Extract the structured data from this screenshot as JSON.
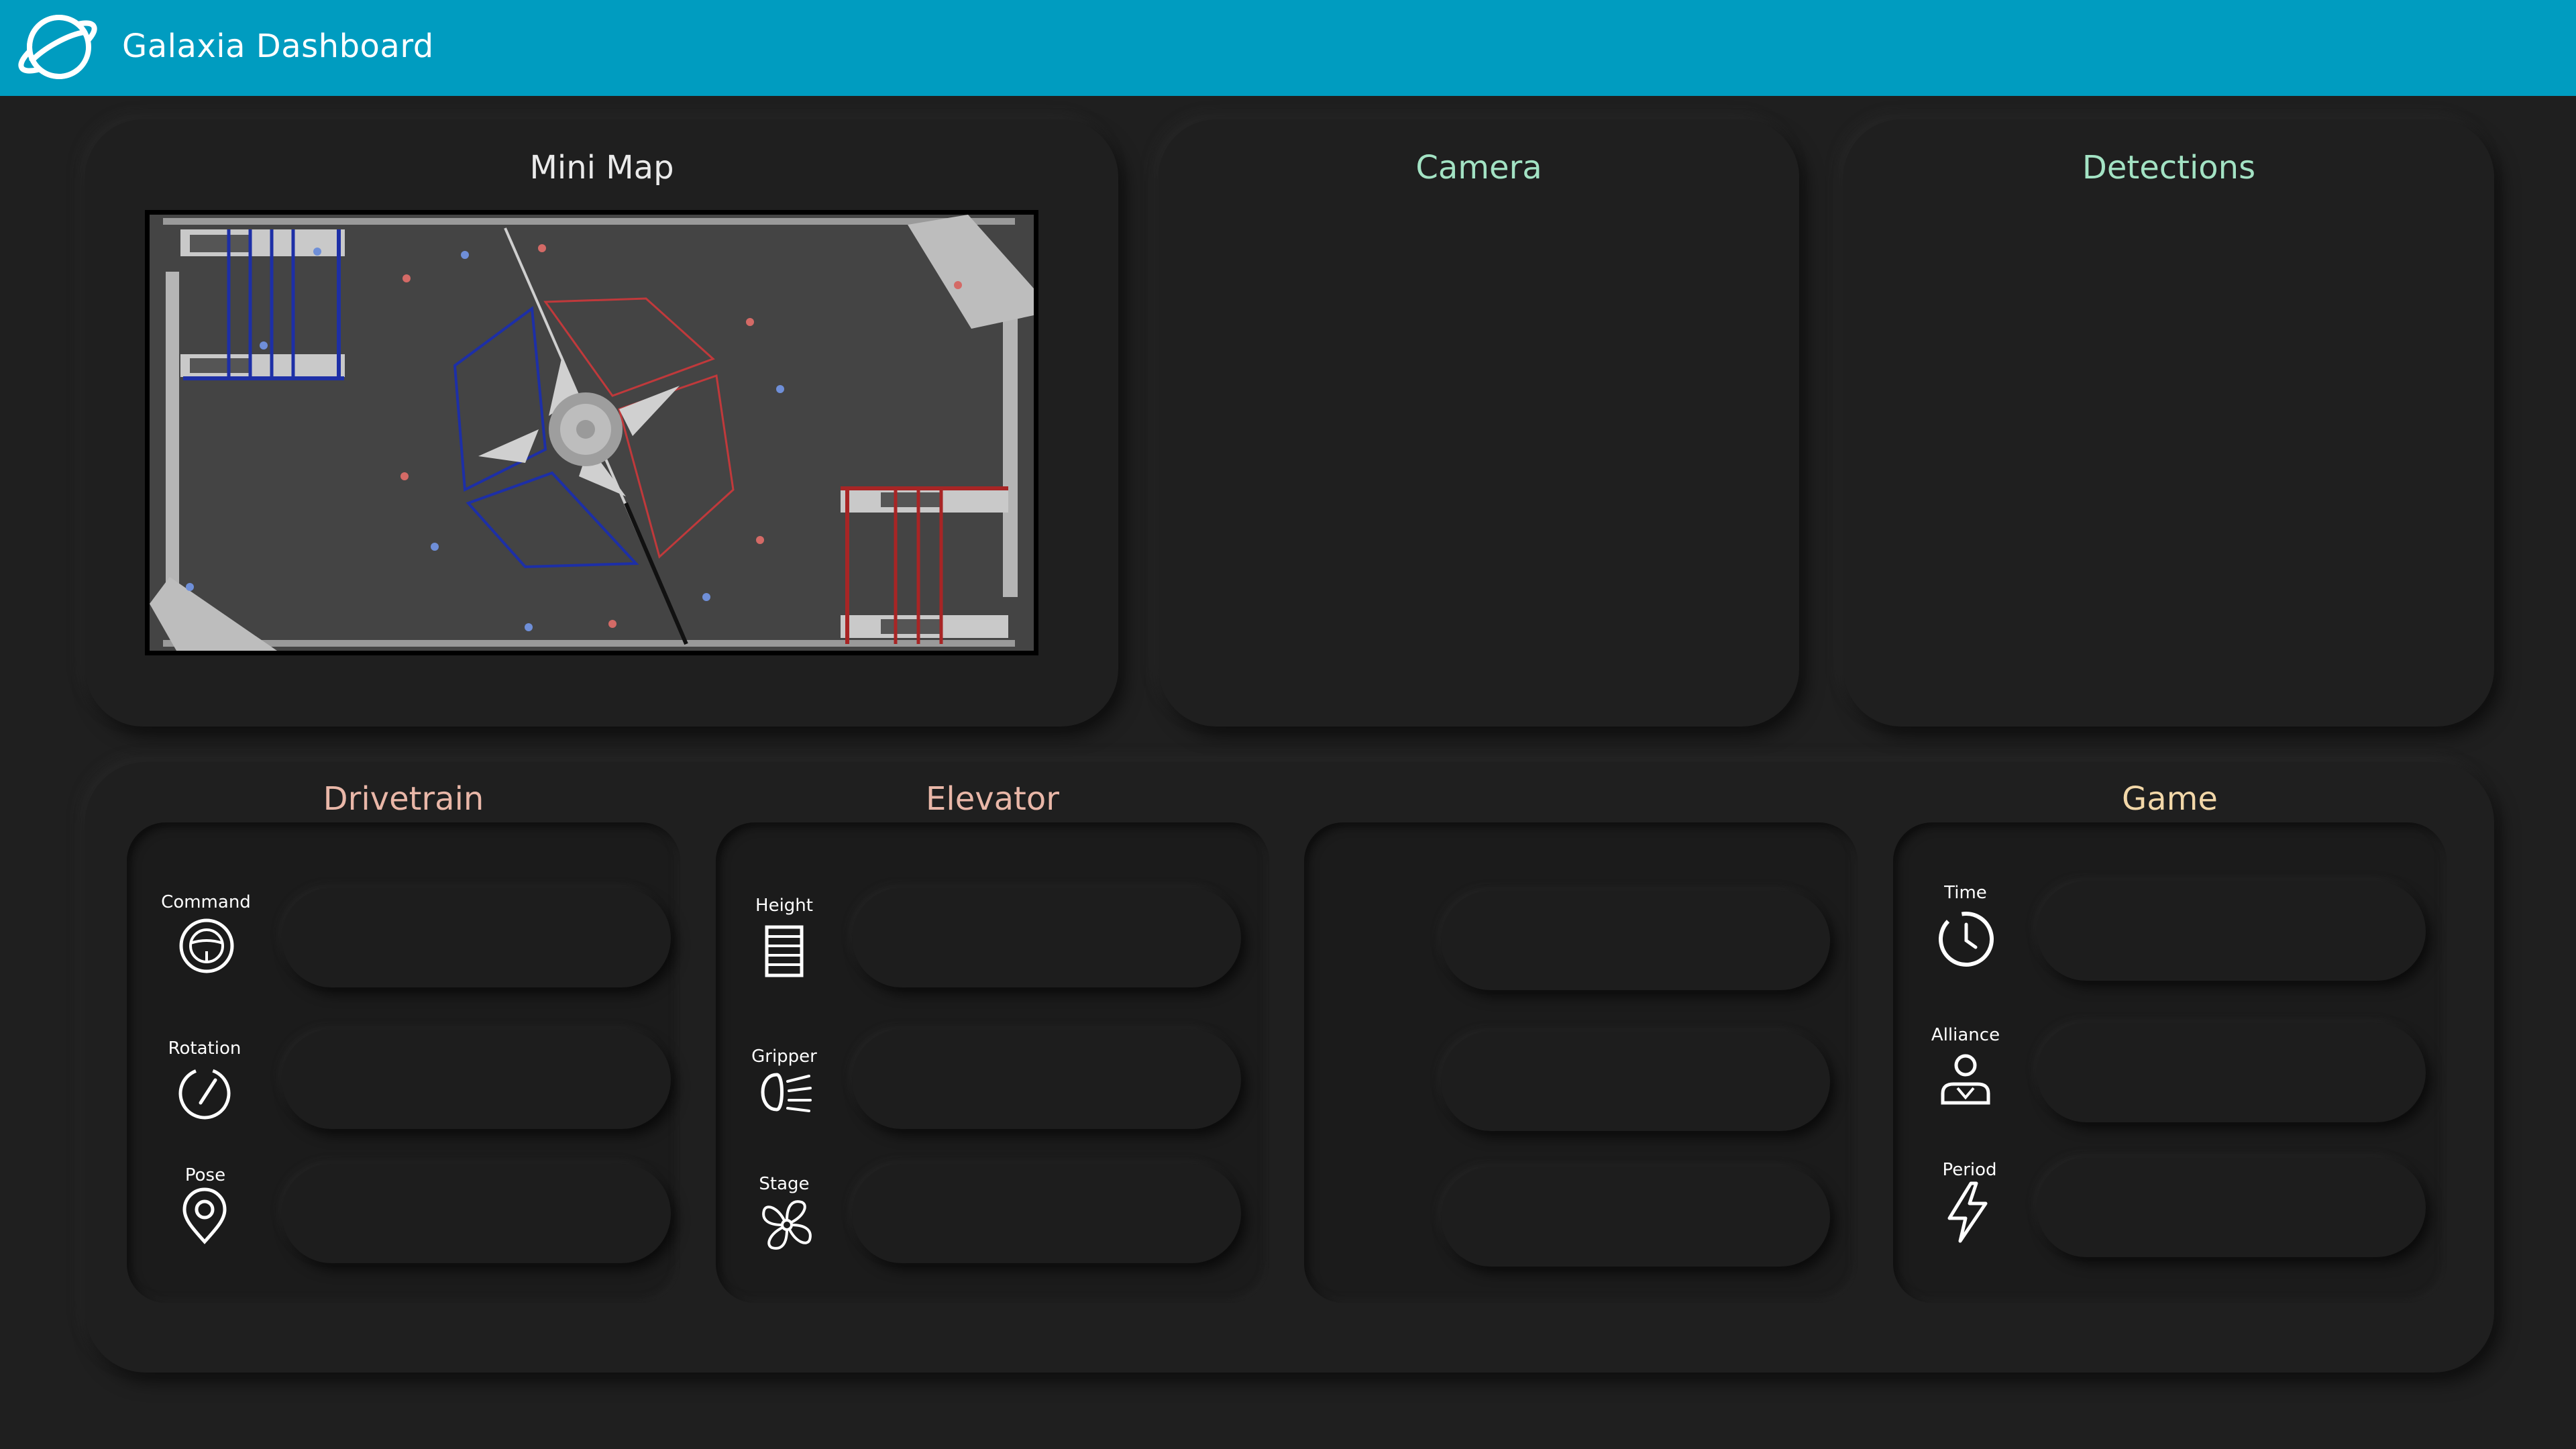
{
  "header": {
    "title": "Galaxia Dashboard",
    "logo_icon": "planet-ring-icon"
  },
  "minimap": {
    "title": "Mini Map",
    "title_color": "#eaeaea",
    "blue_alliance_color": "#1d2fa6",
    "red_alliance_color": "#c0393b"
  },
  "camera": {
    "title": "Camera",
    "title_color": "#a3e3c4"
  },
  "detections": {
    "title": "Detections",
    "title_color": "#a3e3c4"
  },
  "drivetrain": {
    "title": "Drivetrain",
    "fields": [
      {
        "label": "Command",
        "icon": "steering-wheel-icon",
        "value": ""
      },
      {
        "label": "Rotation",
        "icon": "gauge-icon",
        "value": ""
      },
      {
        "label": "Pose",
        "icon": "location-pin-icon",
        "value": ""
      }
    ]
  },
  "elevator": {
    "title": "Elevator",
    "fields": [
      {
        "label": "Height",
        "icon": "ladder-icon",
        "value": ""
      },
      {
        "label": "Gripper",
        "icon": "headlight-icon",
        "value": ""
      },
      {
        "label": "Stage",
        "icon": "fan-icon",
        "value": ""
      }
    ]
  },
  "unlabeled_panel": {
    "fields": [
      {
        "value": ""
      },
      {
        "value": ""
      },
      {
        "value": ""
      }
    ]
  },
  "game": {
    "title": "Game",
    "fields": [
      {
        "label": "Time",
        "icon": "clock-icon",
        "value": ""
      },
      {
        "label": "Alliance",
        "icon": "user-icon",
        "value": ""
      },
      {
        "label": "Period",
        "icon": "lightning-icon",
        "value": ""
      }
    ]
  }
}
